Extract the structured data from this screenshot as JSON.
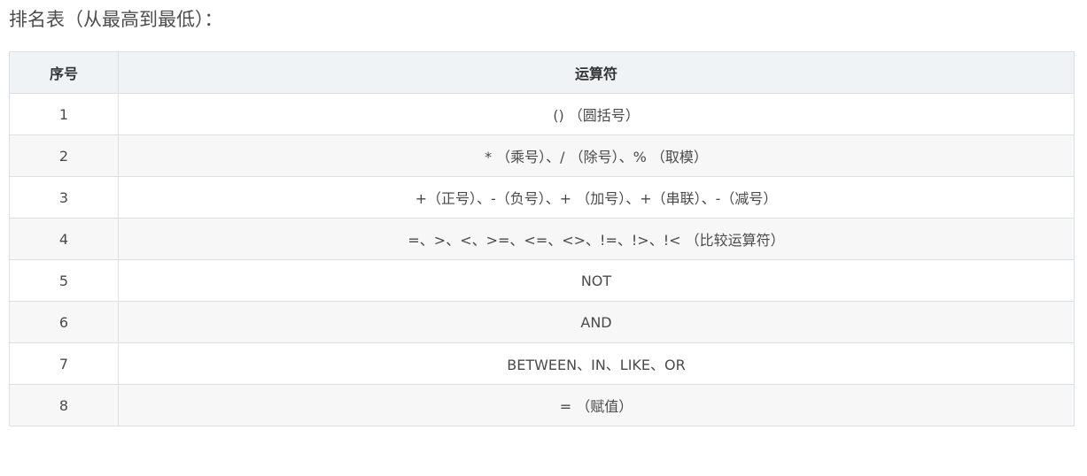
{
  "heading": "排名表（从最高到最低）：",
  "table": {
    "headers": [
      "序号",
      "运算符"
    ],
    "rows": [
      {
        "index": "1",
        "operator": "() （圆括号）"
      },
      {
        "index": "2",
        "operator": "* （乘号）、/ （除号）、% （取模）"
      },
      {
        "index": "3",
        "operator": "+（正号）、-（负号）、+ （加号）、+（串联）、-（减号）"
      },
      {
        "index": "4",
        "operator": "=、>、<、>=、<=、<>、!=、!>、!< （比较运算符）"
      },
      {
        "index": "5",
        "operator": "NOT"
      },
      {
        "index": "6",
        "operator": "AND"
      },
      {
        "index": "7",
        "operator": "BETWEEN、IN、LIKE、OR"
      },
      {
        "index": "8",
        "operator": "= （赋值）"
      }
    ]
  }
}
